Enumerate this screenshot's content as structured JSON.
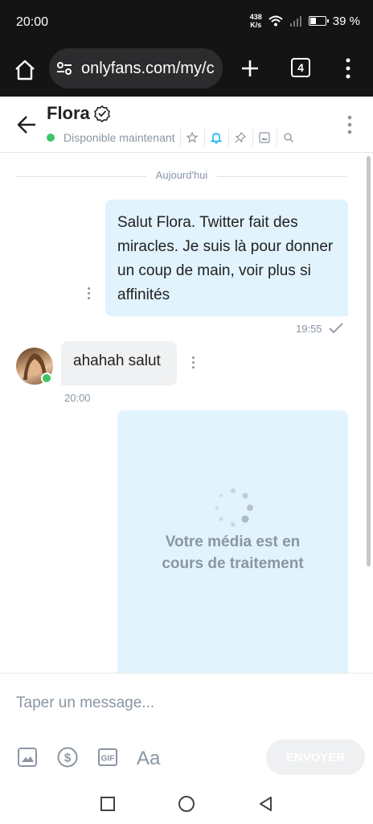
{
  "status_bar": {
    "time": "20:00",
    "net_speed_value": "438",
    "net_speed_unit": "K/s",
    "battery": "39 %"
  },
  "browser": {
    "url": "onlyfans.com/my/c",
    "tab_count": "4"
  },
  "chat": {
    "contact_name": "Flora",
    "status": "Disponible maintenant",
    "accent_color": "#00aff0",
    "online_color": "#3ec466"
  },
  "conversation": {
    "day_separator": "Aujourd'hui",
    "messages": [
      {
        "direction": "out",
        "text": "Salut Flora. Twitter fait des miracles. Je suis là pour donner un coup de main, voir plus si affinités",
        "time": "19:55"
      },
      {
        "direction": "in",
        "text": "ahahah salut",
        "time": "20:00"
      }
    ],
    "media_status": "Votre média est en cours de traitement"
  },
  "composer": {
    "placeholder": "Taper un message...",
    "send_label": "ENVOYER"
  }
}
